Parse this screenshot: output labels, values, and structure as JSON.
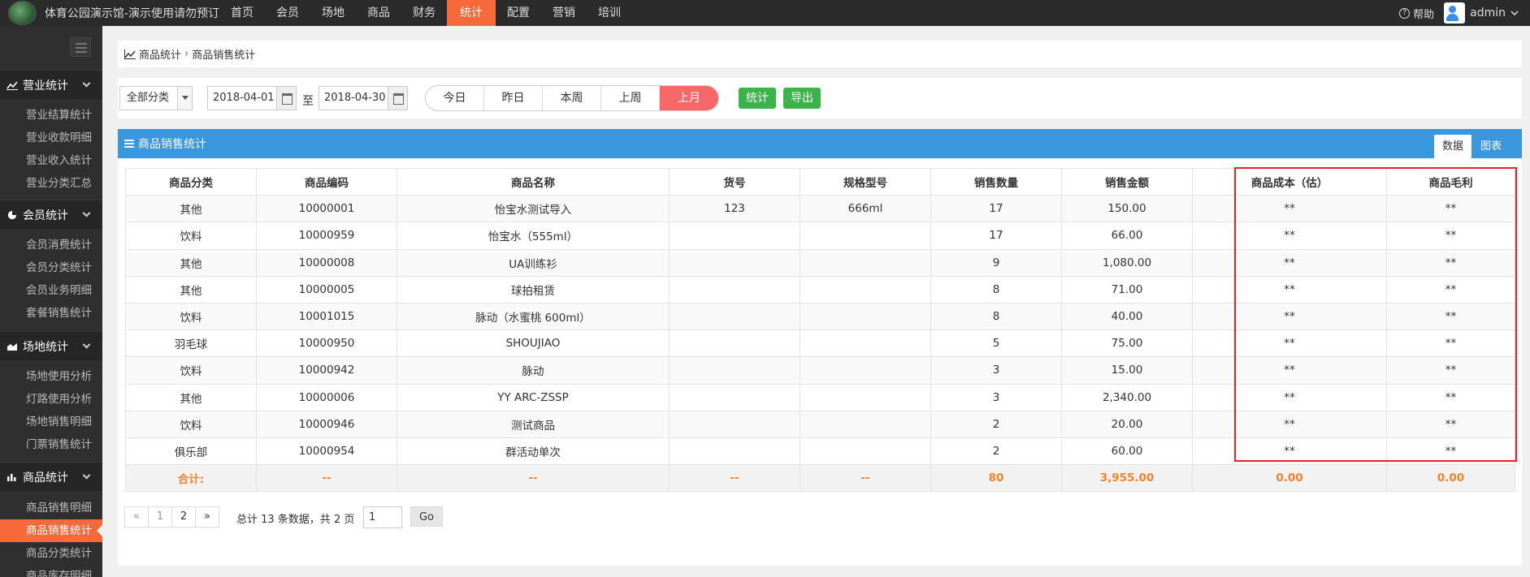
{
  "header": {
    "site_title": "体育公园演示馆-演示使用请勿预订",
    "nav": [
      "首页",
      "会员",
      "场地",
      "商品",
      "财务",
      "统计",
      "配置",
      "营销",
      "培训"
    ],
    "active_nav": "统计",
    "help_label": "帮助",
    "user_name": "admin"
  },
  "sidebar": {
    "groups": [
      {
        "title": "营业统计",
        "items": [
          "营业结算统计",
          "营业收款明细",
          "营业收入统计",
          "营业分类汇总"
        ]
      },
      {
        "title": "会员统计",
        "items": [
          "会员消费统计",
          "会员分类统计",
          "会员业务明细",
          "套餐销售统计"
        ]
      },
      {
        "title": "场地统计",
        "items": [
          "场地使用分析",
          "灯路使用分析",
          "场地销售明细",
          "门票销售统计"
        ]
      },
      {
        "title": "商品统计",
        "items": [
          "商品销售明细",
          "商品销售统计",
          "商品分类统计",
          "商品库存明细"
        ]
      }
    ],
    "active_item": "商品销售统计"
  },
  "breadcrumb": {
    "parent": "商品统计",
    "current": "商品销售统计"
  },
  "filters": {
    "category": "全部分类",
    "date_from": "2018-04-01",
    "to_label": "至",
    "date_to": "2018-04-30",
    "quick_ranges": [
      "今日",
      "昨日",
      "本周",
      "上周",
      "上月"
    ],
    "active_range": "上月",
    "stat_button": "统计",
    "export_button": "导出"
  },
  "panel": {
    "title": "商品销售统计",
    "tabs": [
      "数据",
      "图表"
    ],
    "active_tab": "数据"
  },
  "table": {
    "columns": [
      "商品分类",
      "商品编码",
      "商品名称",
      "货号",
      "规格型号",
      "销售数量",
      "销售金额",
      "商品成本（估）",
      "商品毛利"
    ],
    "rows": [
      [
        "其他",
        "10000001",
        "怡宝水测试导入",
        "123",
        "666ml",
        "17",
        "150.00",
        "**",
        "**"
      ],
      [
        "饮料",
        "10000959",
        "怡宝水（555ml）",
        "",
        "",
        "17",
        "66.00",
        "**",
        "**"
      ],
      [
        "其他",
        "10000008",
        "UA训练衫",
        "",
        "",
        "9",
        "1,080.00",
        "**",
        "**"
      ],
      [
        "其他",
        "10000005",
        "球拍租赁",
        "",
        "",
        "8",
        "71.00",
        "**",
        "**"
      ],
      [
        "饮料",
        "10001015",
        "脉动（水蜜桃 600ml）",
        "",
        "",
        "8",
        "40.00",
        "**",
        "**"
      ],
      [
        "羽毛球",
        "10000950",
        "SHOUJIAO",
        "",
        "",
        "5",
        "75.00",
        "**",
        "**"
      ],
      [
        "饮料",
        "10000942",
        "脉动",
        "",
        "",
        "3",
        "15.00",
        "**",
        "**"
      ],
      [
        "其他",
        "10000006",
        "YY ARC-ZSSP",
        "",
        "",
        "3",
        "2,340.00",
        "**",
        "**"
      ],
      [
        "饮料",
        "10000946",
        "测试商品",
        "",
        "",
        "2",
        "20.00",
        "**",
        "**"
      ],
      [
        "俱乐部",
        "10000954",
        "群活动单次",
        "",
        "",
        "2",
        "60.00",
        "**",
        "**"
      ]
    ],
    "footer": [
      "合计:",
      "--",
      "--",
      "--",
      "--",
      "80",
      "3,955.00",
      "0.00",
      "0.00"
    ]
  },
  "pager": {
    "prev": "«",
    "pages": [
      "1",
      "2"
    ],
    "next": "»",
    "info": "总计 13 条数据，共 2 页",
    "page_input": "1",
    "go_label": "Go"
  },
  "colors": {
    "accent": "#f5693a",
    "panel_header": "#3a96dd",
    "highlight_border": "#e8202a",
    "button_green": "#3cb34a",
    "active_range": "#f96868"
  }
}
